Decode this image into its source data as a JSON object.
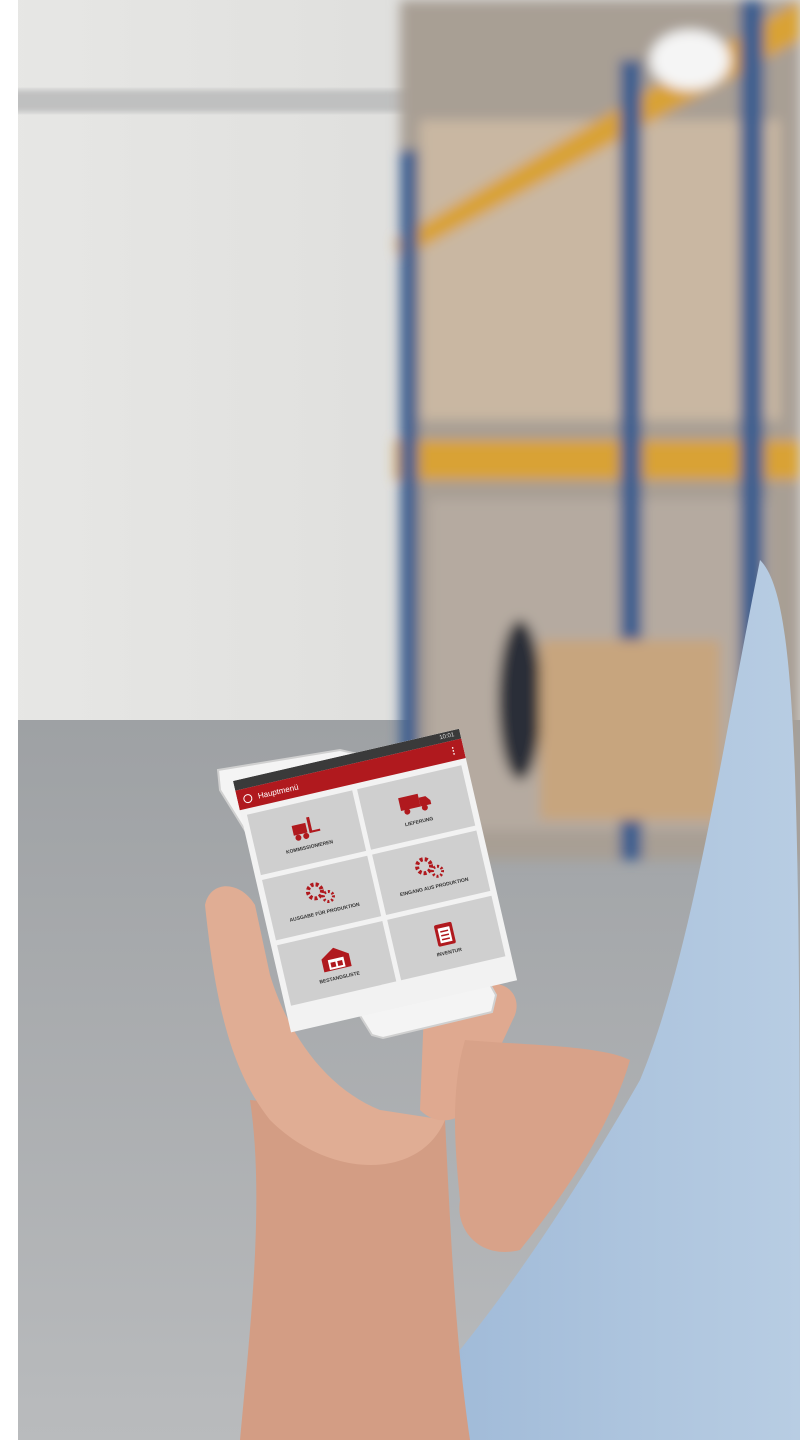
{
  "phone_app": {
    "status_time": "10:01",
    "header": {
      "title": "Hauptmenü"
    },
    "tiles": [
      {
        "label": "KOMMISSIONIEREN",
        "icon": "forklift-icon"
      },
      {
        "label": "LIEFERUNG",
        "icon": "truck-icon"
      },
      {
        "label": "AUSGABE FÜR PRODUKTION",
        "icon": "gears-icon"
      },
      {
        "label": "EINGANG AUS PRODUKTION",
        "icon": "gears-icon"
      },
      {
        "label": "BESTANDSLISTE",
        "icon": "warehouse-icon"
      },
      {
        "label": "INVENTUR",
        "icon": "clipboard-icon"
      }
    ]
  },
  "colors": {
    "brand_red": "#b0191e",
    "tile_gray": "#cfcfcf",
    "rack_orange": "#d9a234",
    "rack_blue": "#3e5f8f",
    "sleeve_blue": "#a9c2dc",
    "skin": "#e0ad94"
  }
}
